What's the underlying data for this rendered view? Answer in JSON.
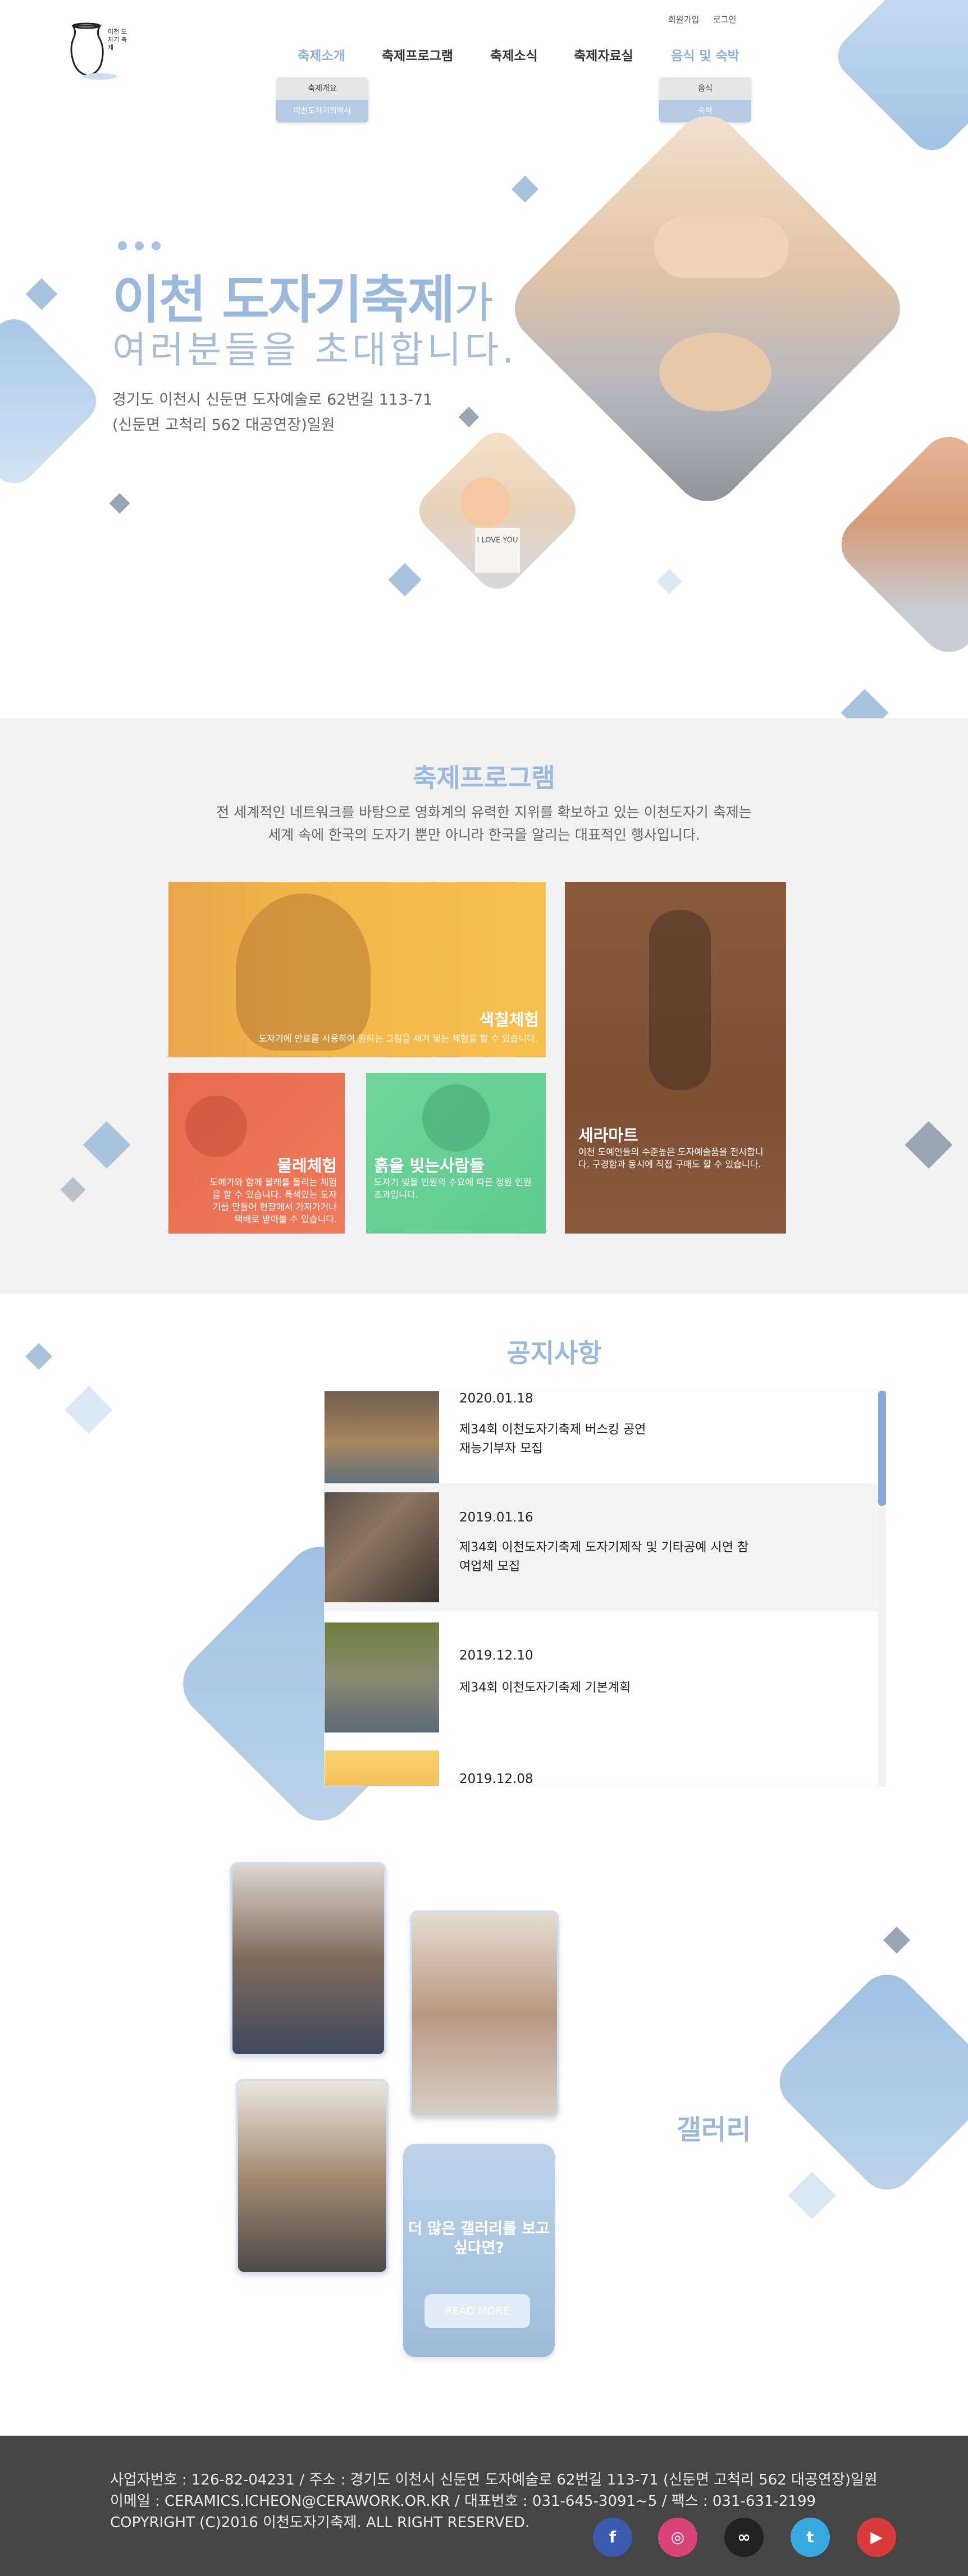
{
  "header": {
    "logo_text": "이천 도자기 축제",
    "util": {
      "signup": "회원가입",
      "login": "로그인"
    },
    "nav": [
      {
        "label": "축제소개"
      },
      {
        "label": "축제프로그램"
      },
      {
        "label": "축제소식"
      },
      {
        "label": "축제자료실"
      },
      {
        "label": "음식 및 숙박"
      }
    ],
    "submenu_intro": [
      "축제개요",
      "이천도자기의역사"
    ],
    "submenu_food": [
      "음식",
      "숙박"
    ]
  },
  "hero": {
    "title_main": "이천 도자기축제",
    "title_suffix": "가",
    "subtitle": "여러분들을 초대합니다.",
    "addr_line1": "경기도 이천시 신둔면 도자예술로 62번길 113-71",
    "addr_line2": "(신둔면 고척리 562 대공연장)일원",
    "sign_text": "I LOVE YOU"
  },
  "program": {
    "title": "축제프로그램",
    "desc_line1": "전 세계적인 네트워크를 바탕으로 영화계의 유력한 지위를 확보하고 있는 이천도자기 축제는",
    "desc_line2": "세계 속에 한국의 도자기 뿐만 아니라 한국을 알리는 대표적인 행사입니다.",
    "cards": [
      {
        "name": "색칠체험",
        "desc": "도자기에 안료를 사용하여 원하는 그림을 새겨 넣는 체험을 할 수 있습니다."
      },
      {
        "name": "물레체험",
        "desc": "도예가와 함께 물레를 돌리는 체험을 할 수 있습니다. 특색있는 도자기를 만들어 현장에서 가져가거나 택배로 받아볼 수 있습니다."
      },
      {
        "name": "흙을 빚는사람들",
        "desc": "도자기 빚을 인원의 수요에 따른 정원 인원 초과입니다."
      },
      {
        "name": "세라마트",
        "desc": "이천 도예인들의 수준높은 도자예술품을 전시합니다. 구경함과 동시에 직접 구매도 할 수 있습니다."
      }
    ]
  },
  "notices": {
    "title": "공지사항",
    "items": [
      {
        "date": "2020.01.18",
        "title": "제34회 이천도자기축제 버스킹 공연 재능기부자 모집"
      },
      {
        "date": "2019.01.16",
        "title": "제34회 이천도자기축제 도자기제작 및 기타공예 시연 참여업체 모집"
      },
      {
        "date": "2019.12.10",
        "title": "제34회 이천도자기축제 기본계획"
      },
      {
        "date": "2019.12.08",
        "title": ""
      }
    ]
  },
  "gallery": {
    "title": "갤러리",
    "more_text": "더 많은 갤러리를 보고 싶다면?",
    "more_btn": "READ MORE"
  },
  "footer": {
    "line1": "사업자번호 : 126-82-04231 / 주소 : 경기도 이천시 신둔면 도자예술로 62번길 113-71 (신둔면 고척리 562 대공연장)일원",
    "line2": "이메일 : CERAMICS.ICHEON@CERAWORK.OR.KR / 대표번호 : 031-645-3091~5 / 팩스 : 031-631-2199",
    "line3": "COPYRIGHT (C)2016 이천도자기축제. ALL RIGHT RESERVED.",
    "social": [
      {
        "name": "facebook",
        "glyph": "f",
        "color": "#3b5bb0"
      },
      {
        "name": "instagram",
        "glyph": "◎",
        "color": "#d9437a"
      },
      {
        "name": "link",
        "glyph": "∞",
        "color": "#222222"
      },
      {
        "name": "twitter",
        "glyph": "t",
        "color": "#38a8e0"
      },
      {
        "name": "youtube",
        "glyph": "▶",
        "color": "#d93a3a"
      }
    ]
  },
  "colors": {
    "accent": "#9ab9dc",
    "footer_bg": "#454545",
    "section_bg": "#f1f1f1"
  }
}
